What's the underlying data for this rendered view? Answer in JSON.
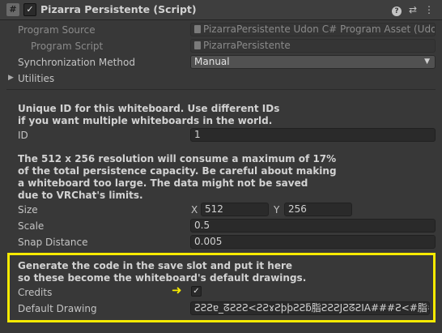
{
  "header": {
    "icon_glyph": "#",
    "enabled_check": "✓",
    "title": "Pizarra Persistente (Script)",
    "help_glyph": "?",
    "presets_glyph": "⇄",
    "menu_glyph": "⋮"
  },
  "fields": {
    "program_source": {
      "label": "Program Source",
      "value": "PizarraPersistente Udon C# Program Asset (Udo"
    },
    "program_script": {
      "label": "Program Script",
      "value": "PizarraPersistente"
    },
    "sync_method": {
      "label": "Synchronization Method",
      "value": "Manual",
      "arrow": "▼"
    },
    "utilities": {
      "label": "Utilities",
      "arrow": "▶"
    }
  },
  "id_section": {
    "info_line1": "Unique ID for this whiteboard. Use different IDs",
    "info_line2": "if you want multiple whiteboards in the world.",
    "id_label": "ID",
    "id_value": "1"
  },
  "size_section": {
    "info_line1": "The 512 x 256 resolution will consume a maximum of 17%",
    "info_line2": "of the total persistence capacity. Be careful about making",
    "info_line3": " a whiteboard too large. The data might not be saved",
    "info_line4": " due to VRChat's limits.",
    "size_label": "Size",
    "x_label": "X",
    "x_value": "512",
    "y_label": "Y",
    "y_value": "256",
    "scale_label": "Scale",
    "scale_value": "0.5",
    "snap_label": "Snap Distance",
    "snap_value": "0.005"
  },
  "drawing_section": {
    "info_line1": "Generate the code in the save slot and put it here",
    "info_line2": " so these become the whiteboard's default drawings.",
    "credits_label": "Credits",
    "credits_check": "✓",
    "pointer_glyph": "➜",
    "default_label": "Default Drawing",
    "default_value": "ƧƧƧɐ_ᘔƧƧƧ<ƧƧɤƧþþƧƧƃ脂ƧƧƧJƧᘔƧIA###Ƨ<#脂##ƧƧƧ"
  },
  "colors": {
    "highlight": "#f7ea00",
    "background": "#383838"
  }
}
